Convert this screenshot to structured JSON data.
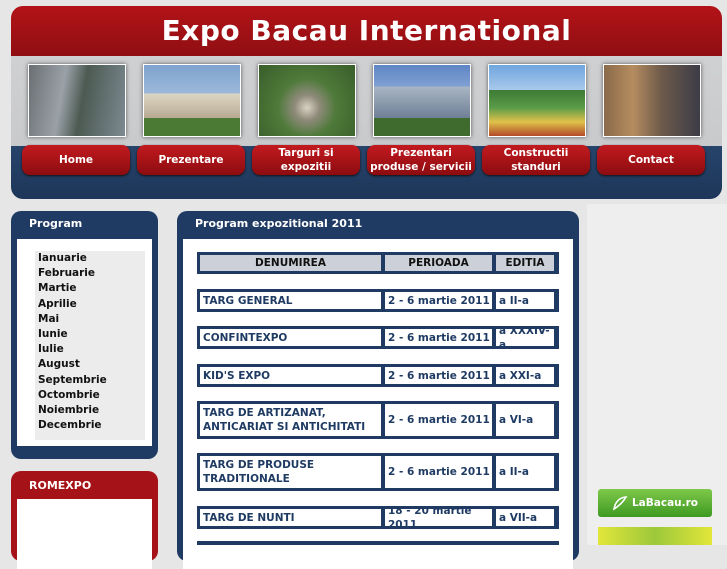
{
  "header": {
    "title": "Expo Bacau International",
    "photos": [
      "city-aerial-photo",
      "palace-photo",
      "park-aerial-photo",
      "office-building-photo",
      "fountain-garden-photo",
      "conference-room-photo"
    ],
    "nav": [
      {
        "label": "Home"
      },
      {
        "label": "Prezentare"
      },
      {
        "label": "Targuri si expozitii"
      },
      {
        "label": "Prezentari produse / servicii"
      },
      {
        "label": "Constructii standuri"
      },
      {
        "label": "Contact"
      }
    ]
  },
  "sidebar": {
    "program_title": "Program expozitional",
    "months": [
      "Ianuarie",
      "Februarie",
      "Martie",
      "Aprilie",
      "Mai",
      "Iunie",
      "Iulie",
      "August",
      "Septembrie",
      "Octombrie",
      "Noiembrie",
      "Decembrie"
    ],
    "romexpo_title": "ROMEXPO"
  },
  "main": {
    "title": "Program expozitional 2011",
    "table": {
      "headers": [
        "DENUMIREA",
        "PERIOADA",
        "EDITIA"
      ],
      "rows": [
        [
          "TARG GENERAL",
          "2 - 6 martie 2011",
          "a II-a"
        ],
        [
          "CONFINTEXPO",
          "2 - 6 martie 2011",
          "a XXXIV-a"
        ],
        [
          "KID'S EXPO",
          "2 - 6 martie 2011",
          "a XXI-a"
        ],
        [
          "TARG DE ARTIZANAT, ANTICARIAT SI ANTICHITATI",
          "2 - 6 martie 2011",
          "a VI-a"
        ],
        [
          "TARG DE PRODUSE TRADITIONALE",
          "2 - 6 martie 2011",
          "a II-a"
        ],
        [
          "TARG DE NUNTI",
          "18 - 20 martie 2011",
          "a VII-a"
        ]
      ]
    }
  },
  "ads": {
    "labacau": "LaBacau.ro"
  },
  "colors": {
    "brand_red": "#a51217",
    "brand_navy": "#1f3b63"
  }
}
